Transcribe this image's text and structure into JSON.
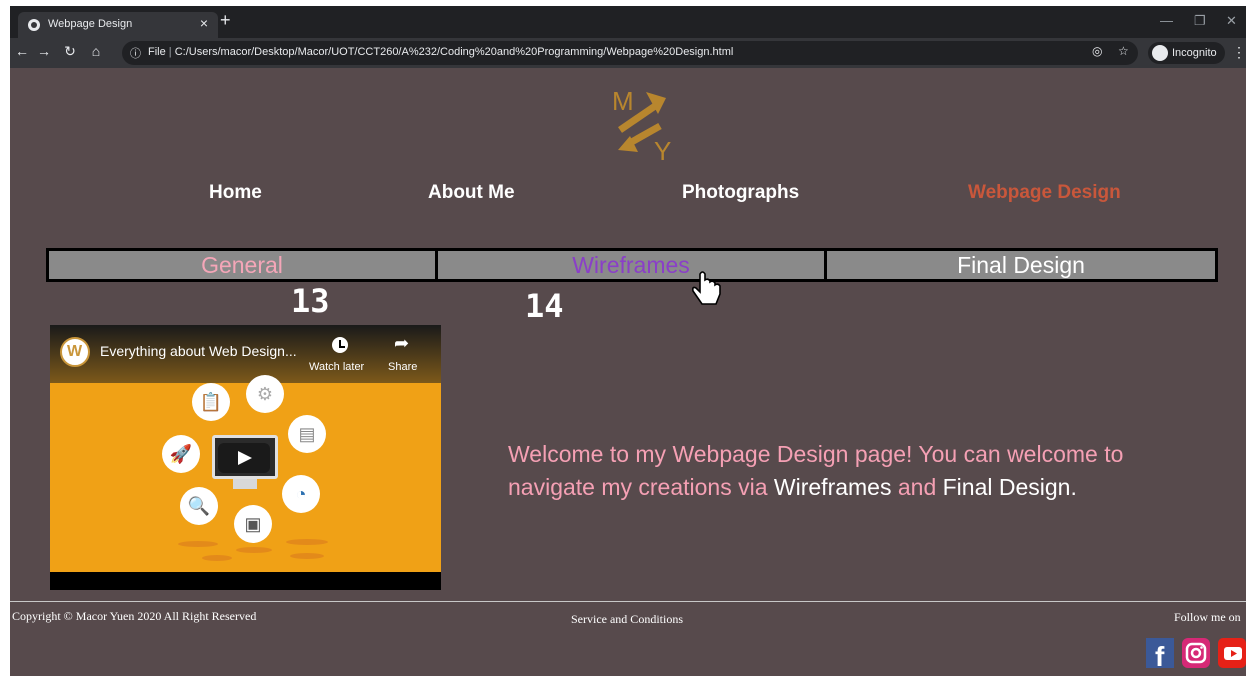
{
  "browser": {
    "tab_title": "Webpage Design",
    "url_scheme": "File",
    "url_path": "C:/Users/macor/Desktop/Macor/UOT/CCT260/A%232/Coding%20and%20Programming/Webpage%20Design.html",
    "incognito_label": "Incognito"
  },
  "logo": {
    "letter_top": "M",
    "letter_bottom": "Y"
  },
  "nav": {
    "home": "Home",
    "about": "About Me",
    "photographs": "Photographs",
    "webpage_design": "Webpage Design"
  },
  "subtabs": {
    "general": "General",
    "wireframes": "Wireframes",
    "final_design": "Final Design"
  },
  "annotations": {
    "label_13": "13",
    "label_14": "14"
  },
  "video": {
    "title": "Everything about Web Design...",
    "watch_later": "Watch later",
    "share": "Share"
  },
  "welcome": {
    "text_before": "Welcome to my Webpage Design page! You can welcome to navigate my creations via ",
    "link_wireframes": "Wireframes",
    "text_and": " and ",
    "link_final": "Final Design",
    "text_end": "."
  },
  "footer": {
    "copyright": "Copyright © Macor Yuen 2020 All Right Reserved",
    "service": "Service and Conditions",
    "follow": "Follow me on"
  },
  "colors": {
    "page_bg": "#574a4c",
    "active_nav": "#c9573b",
    "general_text": "#f4a6b8",
    "wireframes_text": "#8a3fc8",
    "welcome_text": "#f5a0b4",
    "logo": "#b8862e"
  },
  "icons": [
    "back-icon",
    "forward-icon",
    "reload-icon",
    "home-icon",
    "info-icon",
    "eye-off-icon",
    "star-icon",
    "incognito-icon",
    "menu-icon",
    "clock-icon",
    "share-icon",
    "facebook-icon",
    "instagram-icon",
    "youtube-icon",
    "hand-cursor-icon"
  ]
}
